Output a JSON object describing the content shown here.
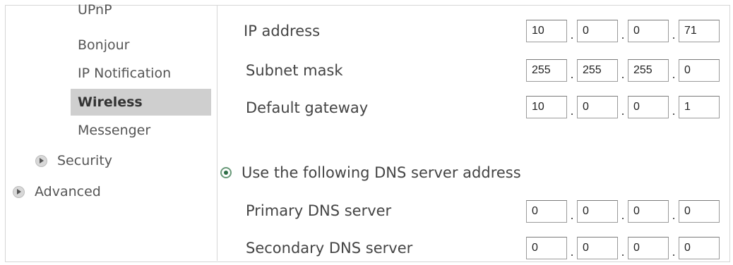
{
  "sidebar": {
    "items": [
      {
        "label": "UPnP"
      },
      {
        "label": "Bonjour"
      },
      {
        "label": "IP Notification"
      },
      {
        "label": "Wireless",
        "selected": true
      },
      {
        "label": "Messenger"
      }
    ],
    "parents": [
      {
        "label": "Security",
        "icon": "chevron-right-icon"
      },
      {
        "label": "Advanced",
        "icon": "chevron-right-icon"
      }
    ]
  },
  "ip_settings": {
    "ip_address": {
      "label": "IP address",
      "octets": [
        "10",
        "0",
        "0",
        "71"
      ]
    },
    "subnet_mask": {
      "label": "Subnet mask",
      "octets": [
        "255",
        "255",
        "255",
        "0"
      ]
    },
    "default_gateway": {
      "label": "Default gateway",
      "octets": [
        "10",
        "0",
        "0",
        "1"
      ]
    }
  },
  "dns": {
    "option_label": "Use the following DNS server address",
    "option_selected": true,
    "primary": {
      "label": "Primary DNS server",
      "octets": [
        "0",
        "0",
        "0",
        "0"
      ]
    },
    "secondary": {
      "label": "Secondary DNS server",
      "octets": [
        "0",
        "0",
        "0",
        "0"
      ]
    }
  },
  "separator": "."
}
